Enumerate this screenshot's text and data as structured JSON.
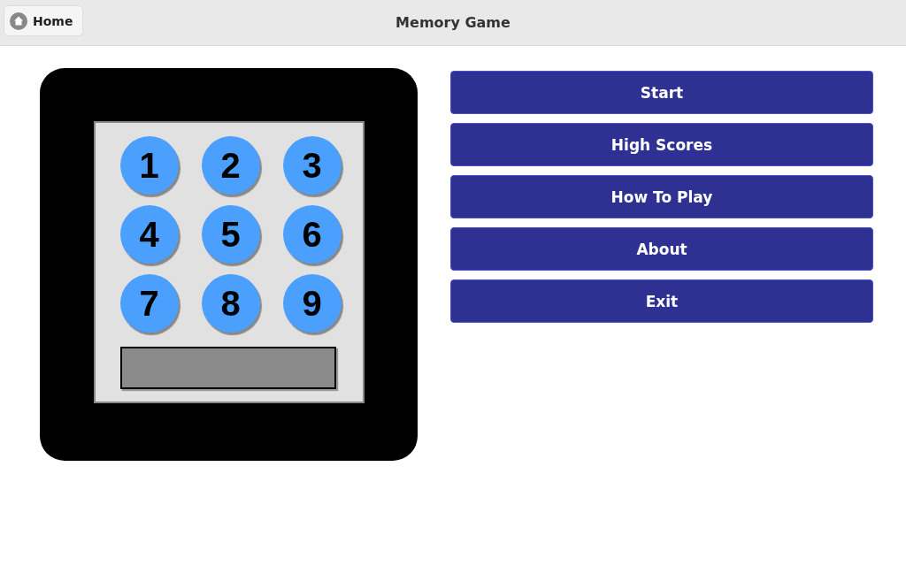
{
  "header": {
    "home_button": "Home",
    "title": "Memory Game"
  },
  "keypad": {
    "keys": [
      "1",
      "2",
      "3",
      "4",
      "5",
      "6",
      "7",
      "8",
      "9"
    ]
  },
  "menu": [
    "Start",
    "High Scores",
    "How To Play",
    "About",
    "Exit"
  ]
}
